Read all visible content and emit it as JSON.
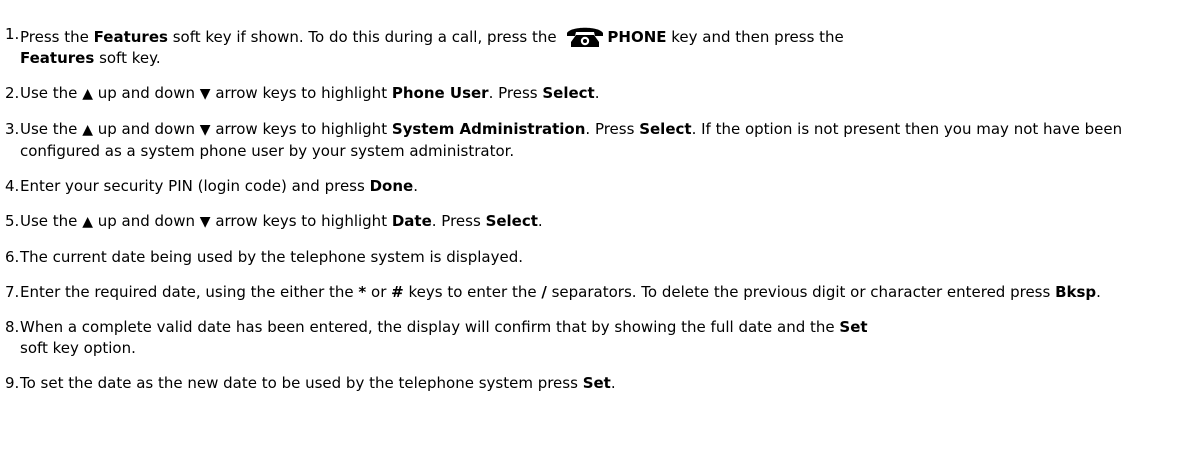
{
  "steps": [
    {
      "num": "1.",
      "parts": [
        "Press the ",
        "Features",
        " soft key if shown. To do this during a call, press the ",
        "PHONE",
        " key and then press the ",
        "Features",
        " soft key."
      ]
    },
    {
      "num": "2.",
      "parts": [
        "Use the ",
        "▲",
        " up and down ",
        "▼",
        " arrow keys to highlight ",
        "Phone User",
        ". Press ",
        "Select",
        "."
      ]
    },
    {
      "num": "3.",
      "parts": [
        "Use the ",
        "▲",
        " up and down ",
        "▼",
        " arrow keys to highlight ",
        "System Administration",
        ". Press ",
        "Select",
        ". If the option is not present then you may not have been configured as a system phone user by your system administrator."
      ]
    },
    {
      "num": "4.",
      "parts": [
        "Enter your security PIN (login code) and press ",
        "Done",
        "."
      ]
    },
    {
      "num": "5.",
      "parts": [
        "Use the ",
        "▲",
        " up and down ",
        "▼",
        " arrow keys to highlight ",
        "Date",
        ". Press ",
        "Select",
        "."
      ]
    },
    {
      "num": "6.",
      "parts": [
        "The current date being used by the telephone system is displayed."
      ]
    },
    {
      "num": "7.",
      "parts": [
        "Enter the required date, using the either the ",
        "*",
        " or ",
        "#",
        " keys to enter the ",
        "/",
        " separators. To delete the previous digit or character entered press ",
        "Bksp",
        "."
      ]
    },
    {
      "num": "8.",
      "parts": [
        "When a complete valid date has been entered, the display will confirm that by showing the full date and the ",
        "Set",
        " soft key option."
      ]
    },
    {
      "num": "9.",
      "parts": [
        "To set the date as the new date to be used by the telephone system press ",
        "Set",
        "."
      ]
    }
  ],
  "icons": {
    "phone_key": "phone-icon",
    "up_arrow": "up-arrow-icon",
    "down_arrow": "down-arrow-icon"
  }
}
